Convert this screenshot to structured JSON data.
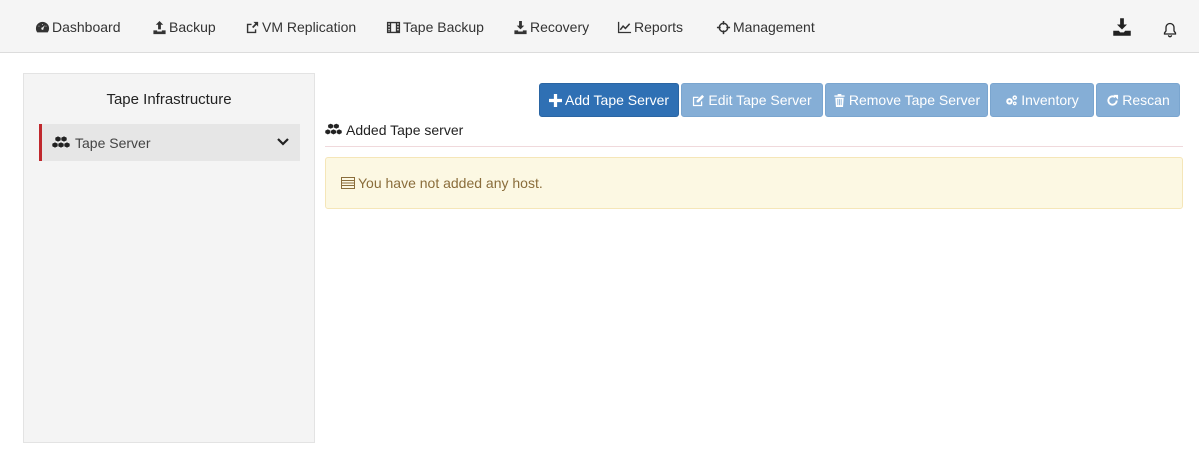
{
  "nav": {
    "items": [
      {
        "label": "Dashboard",
        "icon": "dashboard-icon"
      },
      {
        "label": "Backup",
        "icon": "upload-icon"
      },
      {
        "label": "VM Replication",
        "icon": "share-icon"
      },
      {
        "label": "Tape Backup",
        "icon": "film-icon"
      },
      {
        "label": "Recovery",
        "icon": "download-icon"
      },
      {
        "label": "Reports",
        "icon": "line-chart-icon"
      },
      {
        "label": "Management",
        "icon": "crosshairs-icon"
      }
    ],
    "right_icons": [
      "download-tray-icon",
      "bell-icon"
    ]
  },
  "sidebar": {
    "title": "Tape Infrastructure",
    "items": [
      {
        "label": "Tape Server",
        "icon": "cubes-icon",
        "expand_icon": "chevron-down-icon",
        "accent": "#c0282d"
      }
    ]
  },
  "toolbar": {
    "add_label": "Add Tape Server",
    "edit_label": "Edit Tape Server",
    "remove_label": "Remove Tape Server",
    "inventory_label": "Inventory",
    "rescan_label": "Rescan"
  },
  "section": {
    "title": "Added Tape server"
  },
  "alert": {
    "message": "You have not added any host.",
    "icon": "list-icon"
  },
  "colors": {
    "primary": "#2f70b4",
    "disabled": "#85aed6",
    "alert_bg": "#fcf8e3",
    "alert_text": "#8a6d3b"
  }
}
